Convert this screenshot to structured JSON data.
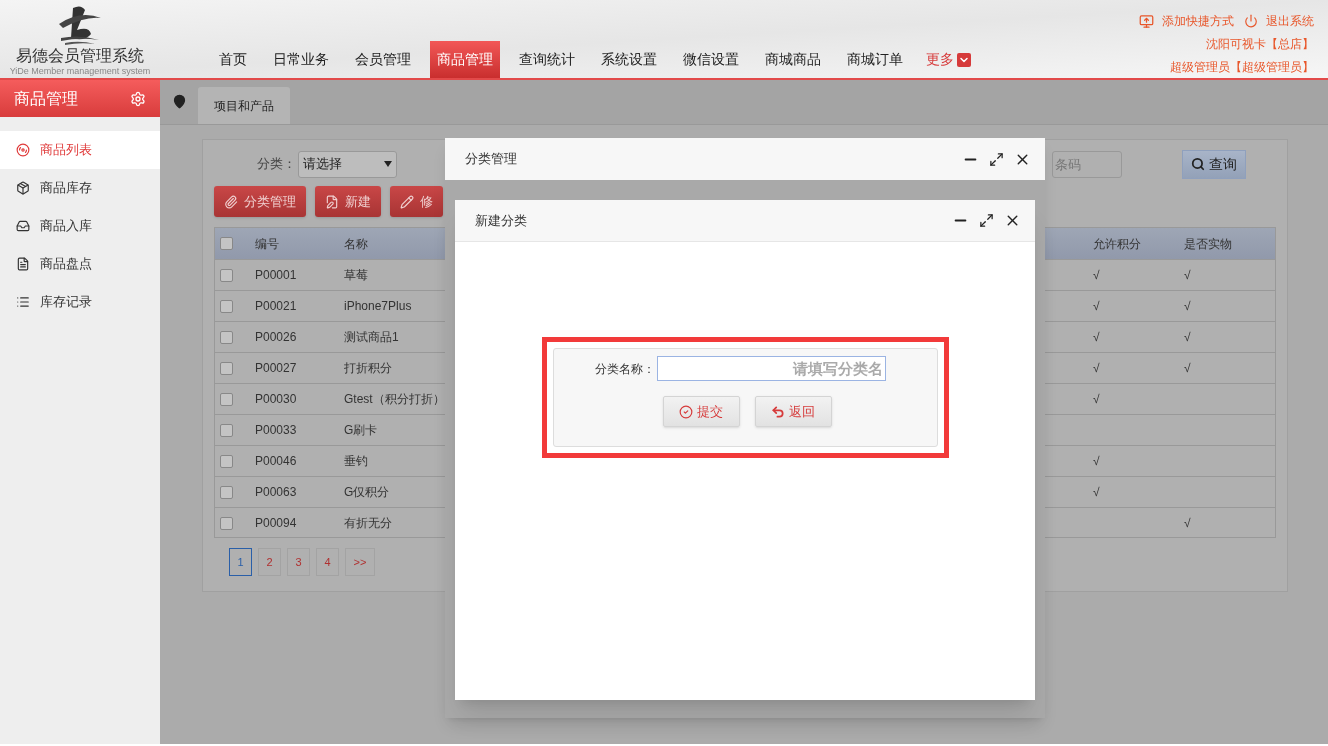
{
  "header": {
    "logo_title": "易德会员管理系统",
    "logo_subtitle": "YiDe Member management system",
    "nav": [
      {
        "label": "首页",
        "selected": false
      },
      {
        "label": "日常业务",
        "selected": false
      },
      {
        "label": "会员管理",
        "selected": false
      },
      {
        "label": "商品管理",
        "selected": true
      },
      {
        "label": "查询统计",
        "selected": false
      },
      {
        "label": "系统设置",
        "selected": false
      },
      {
        "label": "微信设置",
        "selected": false
      },
      {
        "label": "商城商品",
        "selected": false
      },
      {
        "label": "商城订单",
        "selected": false
      }
    ],
    "more": "更多",
    "links": [
      {
        "label": "添加快捷方式",
        "kind": "shortcut"
      },
      {
        "label": "退出系统",
        "kind": "logout"
      }
    ],
    "store": "沈阳可视卡【总店】",
    "user": "超级管理员【超级管理员】"
  },
  "sidebar": {
    "title": "商品管理",
    "items": [
      {
        "label": "商品列表",
        "selected": true
      },
      {
        "label": "商品库存",
        "selected": false
      },
      {
        "label": "商品入库",
        "selected": false
      },
      {
        "label": "商品盘点",
        "selected": false
      },
      {
        "label": "库存记录",
        "selected": false
      }
    ]
  },
  "tabs": [
    {
      "label": "项目和产品",
      "selected": true
    }
  ],
  "filter": {
    "label": "分类：",
    "select": "请选择",
    "search_placeholder": "条码",
    "query": "查询"
  },
  "toolbar": [
    {
      "label": "分类管理"
    },
    {
      "label": "新建"
    },
    {
      "label": "修"
    }
  ],
  "table": {
    "all_checked": false,
    "columns": [
      "编号",
      "名称",
      "允许积分",
      "是否实物"
    ],
    "rows": [
      {
        "checked": false,
        "code": "P00001",
        "name": "草莓",
        "points": "√",
        "physical": "√"
      },
      {
        "checked": false,
        "code": "P00021",
        "name": "iPhone7Plus",
        "points": "√",
        "physical": "√"
      },
      {
        "checked": false,
        "code": "P00026",
        "name": "测试商品1",
        "points": "√",
        "physical": "√"
      },
      {
        "checked": false,
        "code": "P00027",
        "name": "打折积分",
        "points": "√",
        "physical": "√"
      },
      {
        "checked": false,
        "code": "P00030",
        "name": "Gtest（积分打折）",
        "points": "√"
      },
      {
        "checked": false,
        "code": "P00033",
        "name": "G刷卡"
      },
      {
        "checked": false,
        "code": "P00046",
        "name": "垂钓",
        "points": "√"
      },
      {
        "checked": false,
        "code": "P00063",
        "name": "G仅积分",
        "points": "√"
      },
      {
        "checked": false,
        "code": "P00094",
        "name": "有折无分",
        "physical": "√"
      }
    ]
  },
  "pagination": [
    {
      "label": "1",
      "selected": true
    },
    {
      "label": "2",
      "selected": false
    },
    {
      "label": "3",
      "selected": false
    },
    {
      "label": "4",
      "selected": false
    },
    {
      "label": ">>",
      "selected": false
    }
  ],
  "dialogs": {
    "outer": {
      "title": "分类管理"
    },
    "inner": {
      "title": "新建分类",
      "form": {
        "label": "分类名称：",
        "placeholder": "请填写分类名",
        "buttons": [
          {
            "label": "提交",
            "kind": "submit"
          },
          {
            "label": "返回",
            "kind": "back"
          }
        ]
      }
    }
  }
}
